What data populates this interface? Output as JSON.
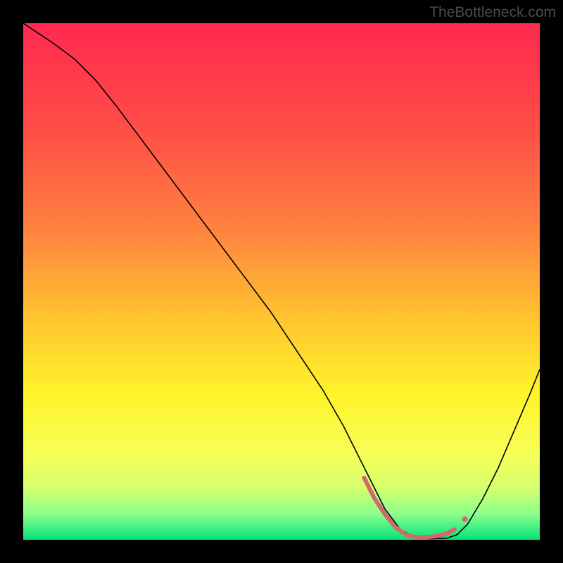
{
  "watermark": "TheBottleneck.com",
  "chart_data": {
    "type": "line",
    "title": "",
    "xlabel": "",
    "ylabel": "",
    "xlim": [
      0,
      100
    ],
    "ylim": [
      0,
      100
    ],
    "background_gradient": {
      "stops": [
        {
          "offset": 0,
          "color": "#ff2a4f"
        },
        {
          "offset": 18,
          "color": "#ff4848"
        },
        {
          "offset": 40,
          "color": "#ff823f"
        },
        {
          "offset": 58,
          "color": "#ffc72f"
        },
        {
          "offset": 72,
          "color": "#fff42a"
        },
        {
          "offset": 84,
          "color": "#f5ff5a"
        },
        {
          "offset": 90,
          "color": "#d4ff6e"
        },
        {
          "offset": 95,
          "color": "#8cff8c"
        },
        {
          "offset": 100,
          "color": "#05e27a"
        }
      ]
    },
    "series": [
      {
        "name": "bottleneck-curve",
        "stroke": "#000000",
        "stroke_width": 1.6,
        "x": [
          0,
          3,
          6,
          10,
          14,
          18,
          24,
          30,
          36,
          42,
          48,
          54,
          58,
          62,
          65,
          67,
          70,
          73,
          76,
          79,
          82,
          84,
          86,
          89,
          92,
          95,
          98,
          100
        ],
        "y": [
          100,
          98,
          96,
          93,
          89,
          84,
          76,
          68,
          60,
          52,
          44,
          35,
          29,
          22,
          16,
          12,
          6,
          2,
          0.3,
          0.2,
          0.3,
          1,
          3,
          8,
          14,
          21,
          28,
          33
        ]
      },
      {
        "name": "bottleneck-marker-band",
        "stroke": "#cf6a6e",
        "stroke_width": 6,
        "linecap": "round",
        "x": [
          66,
          68,
          70,
          72,
          74,
          76,
          78,
          80,
          82,
          83.5
        ],
        "y": [
          12,
          8,
          5,
          2.5,
          1,
          0.5,
          0.5,
          0.7,
          1.2,
          2
        ]
      }
    ],
    "points": [
      {
        "name": "end-dot",
        "x": 85.5,
        "y": 4,
        "r": 4,
        "fill": "#cf6a6e"
      }
    ]
  }
}
